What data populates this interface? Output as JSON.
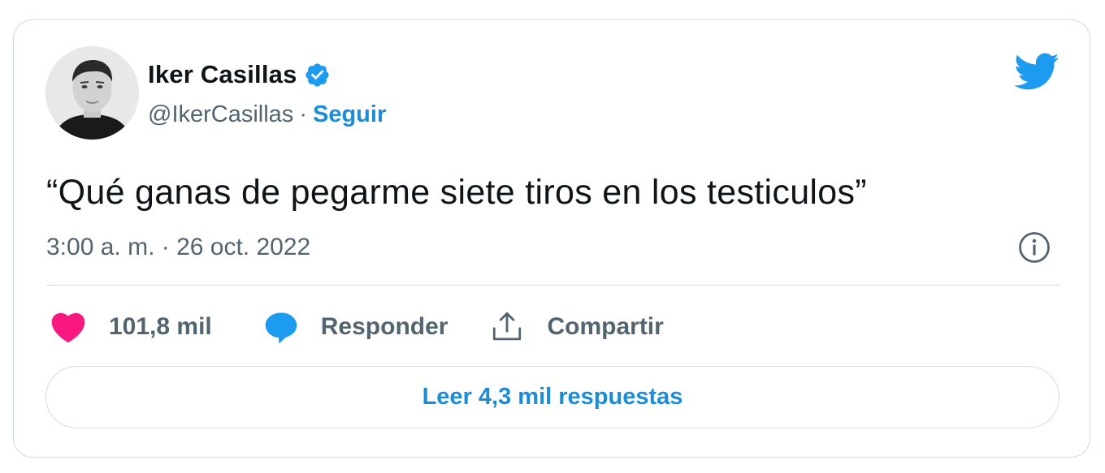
{
  "tweet": {
    "author_name": "Iker Casillas",
    "handle": "@IkerCasillas",
    "separator": "·",
    "follow_label": "Seguir",
    "text": "“Qué ganas de pegarme siete tiros en los testiculos”",
    "timestamp": "3:00 a. m. · 26 oct. 2022"
  },
  "actions": {
    "likes_label": "101,8 mil",
    "reply_label": "Responder",
    "share_label": "Compartir"
  },
  "read_replies_label": "Leer 4,3 mil respuestas",
  "icons": {
    "verified": "verified-badge-icon",
    "brand": "twitter-bird-icon",
    "info": "info-icon",
    "like": "heart-icon",
    "reply": "speech-bubble-icon",
    "share": "share-icon"
  },
  "colors": {
    "accent": "#1d9bf0",
    "like": "#f91880",
    "text": "#0f1419",
    "muted": "#536471",
    "border": "#cfd9de"
  }
}
